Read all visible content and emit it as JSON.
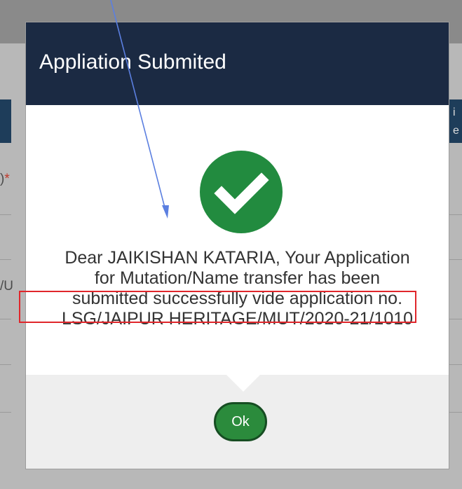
{
  "background_page": {
    "left_fragments": [
      "*",
      "/U"
    ],
    "right_fragments": [
      "i",
      "e"
    ]
  },
  "modal": {
    "title": "Appliation Submited",
    "icon": "check-circle-icon",
    "message_line1": "Dear JAIKISHAN KATARIA, Your Application",
    "message_line2": "for Mutation/Name transfer has been",
    "message_line3": "submitted successfully vide application no.",
    "application_no": "LSG/JAIPUR HERITAGE/MUT/2020-21/1010",
    "ok_label": "Ok"
  },
  "colors": {
    "header_bg": "#1b2a43",
    "success_green": "#228b3f",
    "highlight_red": "#e0262b",
    "annotation_arrow": "#5b7fe0"
  }
}
